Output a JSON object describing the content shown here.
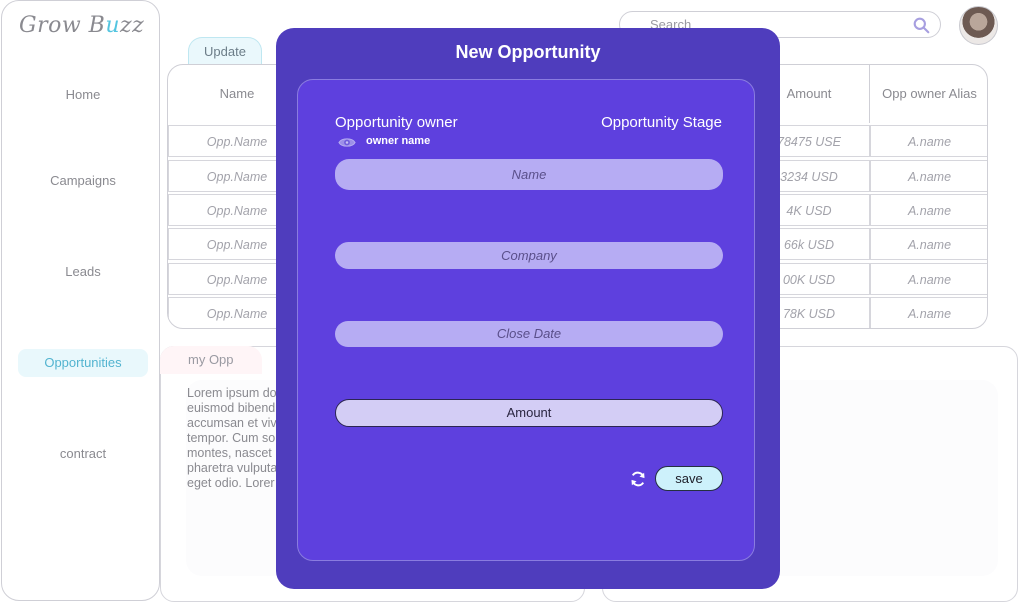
{
  "app": {
    "logo_text_1": "Grow B",
    "logo_text_2": "u",
    "logo_text_3": "zz"
  },
  "sidebar": {
    "items": [
      {
        "label": "Home"
      },
      {
        "label": "Campaigns"
      },
      {
        "label": "Leads"
      },
      {
        "label": "Opportunities"
      },
      {
        "label": "contract"
      }
    ]
  },
  "search": {
    "placeholder": "Search"
  },
  "tabs": {
    "update": "Update",
    "my_opp": "my Opp"
  },
  "table": {
    "headers": {
      "name": "Name",
      "amount": "Amount",
      "owner_alias": "Opp owner Alias"
    },
    "rows": [
      {
        "name": "Opp.Name",
        "amount": "78475 USE",
        "alias": "A.name"
      },
      {
        "name": "Opp.Name",
        "amount": "3234 USD",
        "alias": "A.name"
      },
      {
        "name": "Opp.Name",
        "amount": "4K USD",
        "alias": "A.name"
      },
      {
        "name": "Opp.Name",
        "amount": "66k USD",
        "alias": "A.name"
      },
      {
        "name": "Opp.Name",
        "amount": "00K USD",
        "alias": "A.name"
      },
      {
        "name": "Opp.Name",
        "amount": "78K USD",
        "alias": "A.name"
      }
    ]
  },
  "lorem": "Lorem ipsum do\neuismod bibend\naccumsan et viv\ntempor. Cum so\nmontes, nascet\npharetra vulputa\neget odio. Lorer",
  "modal": {
    "title": "New Opportunity",
    "owner_label": "Opportunity owner",
    "stage_label": "Opportunity Stage",
    "owner_name": "owner name",
    "fields": {
      "name": "Name",
      "company": "Company",
      "close_date": "Close Date",
      "amount": "Amount"
    },
    "save_label": "save"
  },
  "colors": {
    "modal_bg": "#4f3dbd",
    "modal_card": "#5e40de",
    "field_bg": "#b6acf3",
    "save_bg": "#cdf1fb",
    "active_nav": "#e9f8fc"
  }
}
